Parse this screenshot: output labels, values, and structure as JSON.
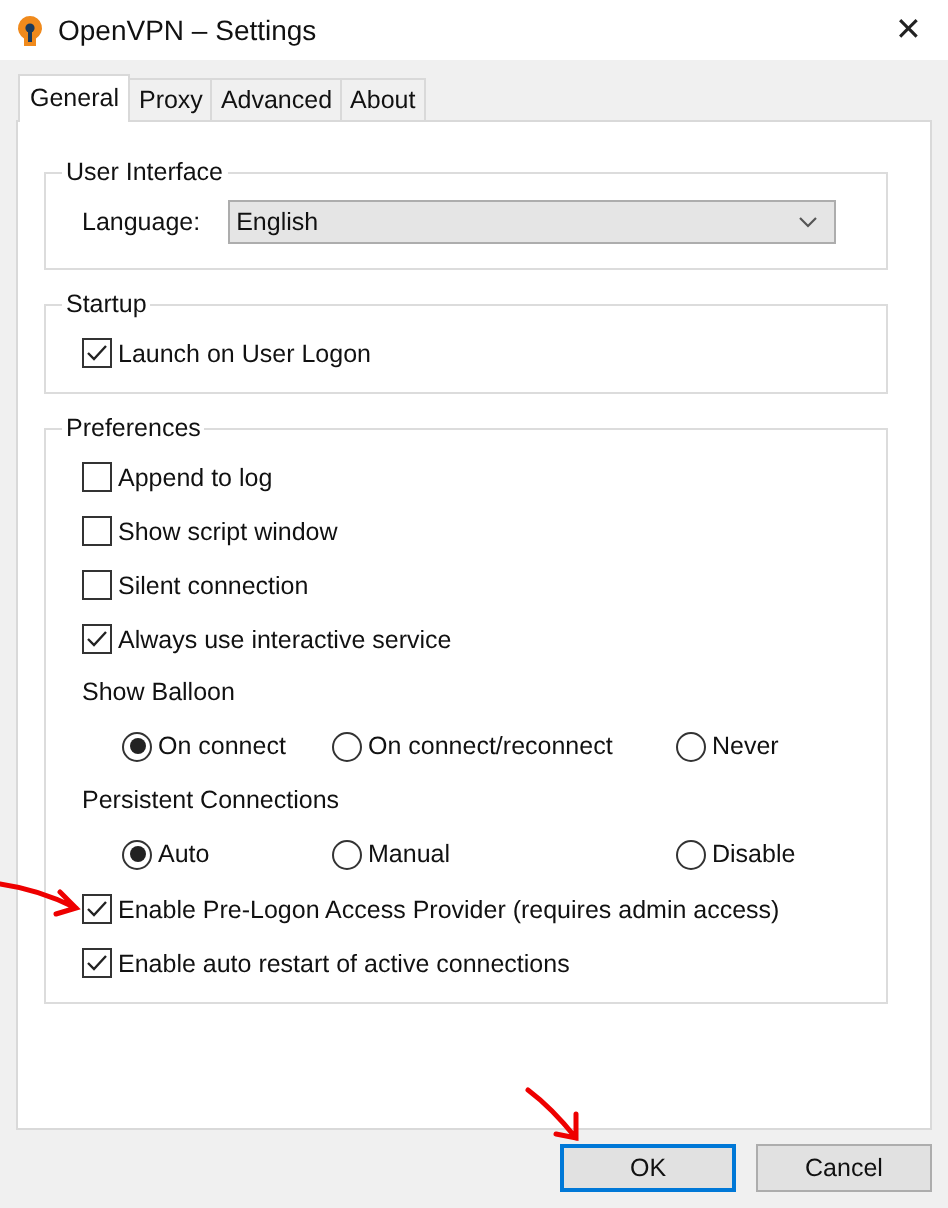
{
  "window": {
    "title": "OpenVPN – Settings",
    "close": "✕"
  },
  "tabs": [
    {
      "label": "General",
      "selected": true
    },
    {
      "label": "Proxy",
      "selected": false
    },
    {
      "label": "Advanced",
      "selected": false
    },
    {
      "label": "About",
      "selected": false
    }
  ],
  "groups": [
    {
      "title": "User Interface",
      "items": [
        {
          "kind": "dropdown",
          "label": "Language:",
          "value": "English"
        }
      ]
    },
    {
      "title": "Startup",
      "items": [
        {
          "kind": "checkbox",
          "label": "Launch on User Logon",
          "checked": true
        }
      ]
    },
    {
      "title": "Preferences",
      "items": [
        {
          "kind": "checkbox",
          "label": "Append to log",
          "checked": false
        },
        {
          "kind": "checkbox",
          "label": "Show script window",
          "checked": false
        },
        {
          "kind": "checkbox",
          "label": "Silent connection",
          "checked": false
        },
        {
          "kind": "checkbox",
          "label": "Always use interactive service",
          "checked": true
        },
        {
          "kind": "heading",
          "label": "Show Balloon"
        },
        {
          "kind": "radios",
          "options": [
            {
              "label": "On connect",
              "selected": true
            },
            {
              "label": "On connect/reconnect",
              "selected": false
            },
            {
              "label": "Never",
              "selected": false
            }
          ]
        },
        {
          "kind": "heading",
          "label": "Persistent Connections"
        },
        {
          "kind": "radios",
          "options": [
            {
              "label": "Auto",
              "selected": true
            },
            {
              "label": "Manual",
              "selected": false
            },
            {
              "label": "Disable",
              "selected": false
            }
          ]
        },
        {
          "kind": "checkbox",
          "label": "Enable Pre-Logon Access Provider (requires admin access)",
          "checked": true
        },
        {
          "kind": "checkbox",
          "label": "Enable auto restart of active connections",
          "checked": true
        }
      ]
    }
  ],
  "buttons": [
    {
      "label": "OK",
      "default": true
    },
    {
      "label": "Cancel",
      "default": false
    }
  ]
}
